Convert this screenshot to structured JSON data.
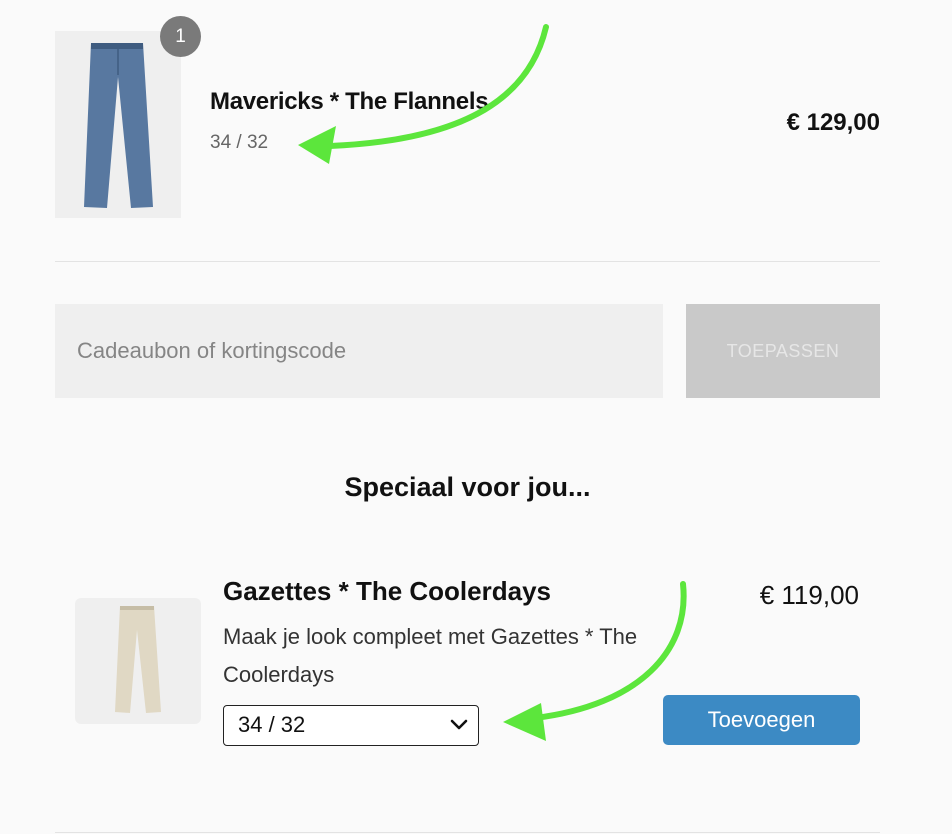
{
  "cart_item": {
    "quantity": "1",
    "title": "Mavericks * The Flannels",
    "size": "34 / 32",
    "price": "€ 129,00",
    "image_icon": "blue-trousers-image"
  },
  "discount": {
    "placeholder": "Cadeaubon of kortingscode",
    "apply_label": "TOEPASSEN"
  },
  "upsell": {
    "heading": "Speciaal voor jou...",
    "title": "Gazettes * The Coolerdays",
    "description": "Maak je look compleet met Gazettes * The Coolerdays",
    "price": "€ 119,00",
    "selected_size": "34 / 32",
    "add_label": "Toevoegen",
    "image_icon": "beige-trousers-image"
  },
  "colors": {
    "accent": "#3c8ac4",
    "annotation_arrow": "#5ce63c",
    "badge": "#7a7a7a"
  }
}
